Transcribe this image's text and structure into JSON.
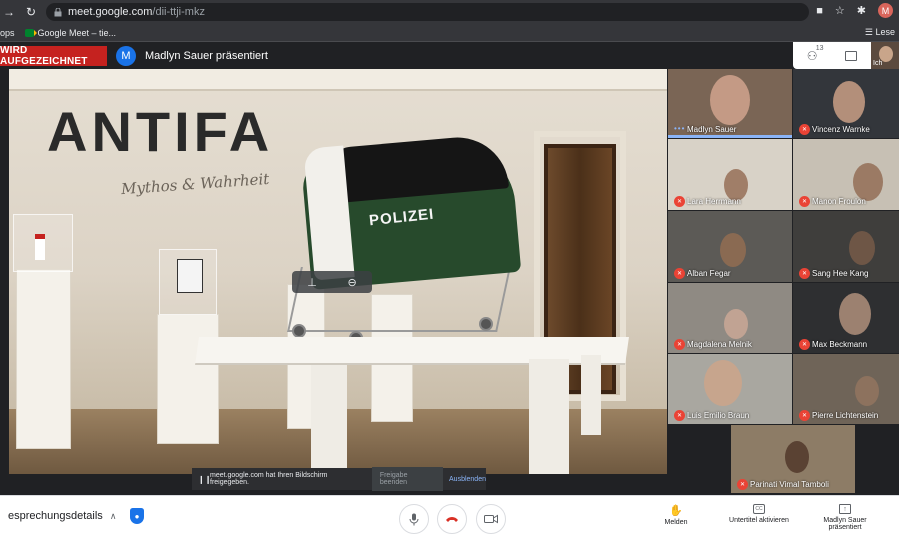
{
  "browser": {
    "url_host": "meet.google.com",
    "url_path": "/dii-ttji-mkz",
    "bookmarks": {
      "apps": "ops",
      "meet": "Google Meet – tie...",
      "reading_list": "Lese"
    },
    "profile_initial": "M"
  },
  "meet": {
    "recording_badge": "WIRD AUFGEZEICHNET",
    "presenter_initial": "M",
    "presenter_text": "Madlyn Sauer präsentiert",
    "participant_count": "13",
    "self_label": "Ich"
  },
  "stage": {
    "wall_text": "ANTIFA",
    "script_text": "Mythos & Wahrheit",
    "car_text": "POLIZEI",
    "toolbar": {
      "pin": "⊥",
      "remove": "⊖"
    }
  },
  "share_bar": {
    "text": "meet.google.com hat Ihren Bildschirm freigegeben.",
    "stop": "Freigabe beenden",
    "hide": "Ausblenden"
  },
  "participants": [
    {
      "name": "Madlyn Sauer",
      "muted": false
    },
    {
      "name": "Vincenz Warnke",
      "muted": true
    },
    {
      "name": "Lara Herrmann",
      "muted": true
    },
    {
      "name": "Manon Froulon",
      "muted": true
    },
    {
      "name": "Alban Fegar",
      "muted": true
    },
    {
      "name": "Sang Hee Kang",
      "muted": true
    },
    {
      "name": "Magdalena Melnik",
      "muted": true
    },
    {
      "name": "Max Beckmann",
      "muted": true
    },
    {
      "name": "Luis Emilio Braun",
      "muted": true
    },
    {
      "name": "Pierre Lichtenstein",
      "muted": true
    },
    {
      "name": "Parinati Vimal Tamboli",
      "muted": true
    }
  ],
  "bottom": {
    "details": "esprechungsdetails",
    "report": "Melden",
    "captions": "Untertitel aktivieren",
    "present_line1": "Madlyn Sauer",
    "present_line2": "präsentiert",
    "cc_text": "CC"
  },
  "colors": {
    "record_red": "#c5221f",
    "meet_blue": "#1a73e8",
    "mute_red": "#ea4335",
    "dark_bg": "#202124"
  }
}
